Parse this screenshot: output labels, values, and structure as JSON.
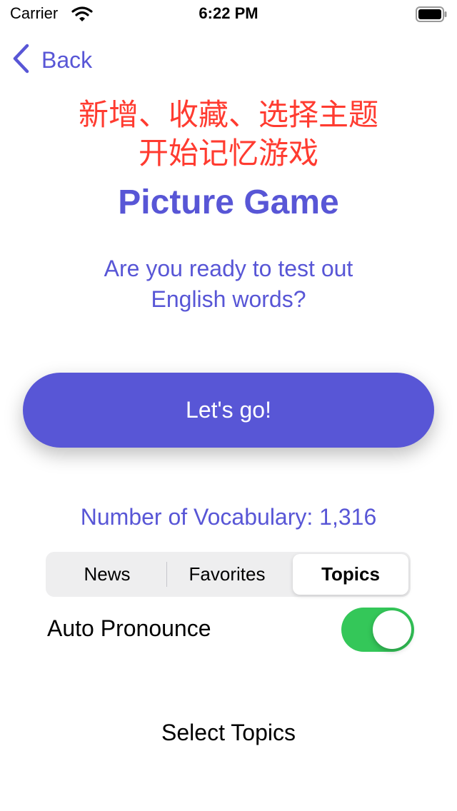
{
  "status_bar": {
    "carrier": "Carrier",
    "time": "6:22 PM",
    "wifi_icon": "wifi-icon",
    "battery_icon": "battery-icon"
  },
  "nav": {
    "back_label": "Back",
    "back_icon": "chevron-left-icon"
  },
  "annotation": {
    "line1": "新增、收藏、选择主题",
    "line2": "开始记忆游戏"
  },
  "main": {
    "title": "Picture Game",
    "subtitle_line1": "Are you ready to test out",
    "subtitle_line2": "English words?",
    "go_button": "Let's go!",
    "vocab_count": "Number of Vocabulary: 1,316"
  },
  "segments": {
    "items": [
      "News",
      "Favorites",
      "Topics"
    ],
    "selected": "Topics"
  },
  "settings": {
    "auto_pronounce_label": "Auto Pronounce",
    "auto_pronounce_on": true
  },
  "footer": {
    "select_topics": "Select Topics"
  },
  "colors": {
    "accent": "#5856d6",
    "annotation": "#ff3b30",
    "toggle_on": "#34c759"
  }
}
